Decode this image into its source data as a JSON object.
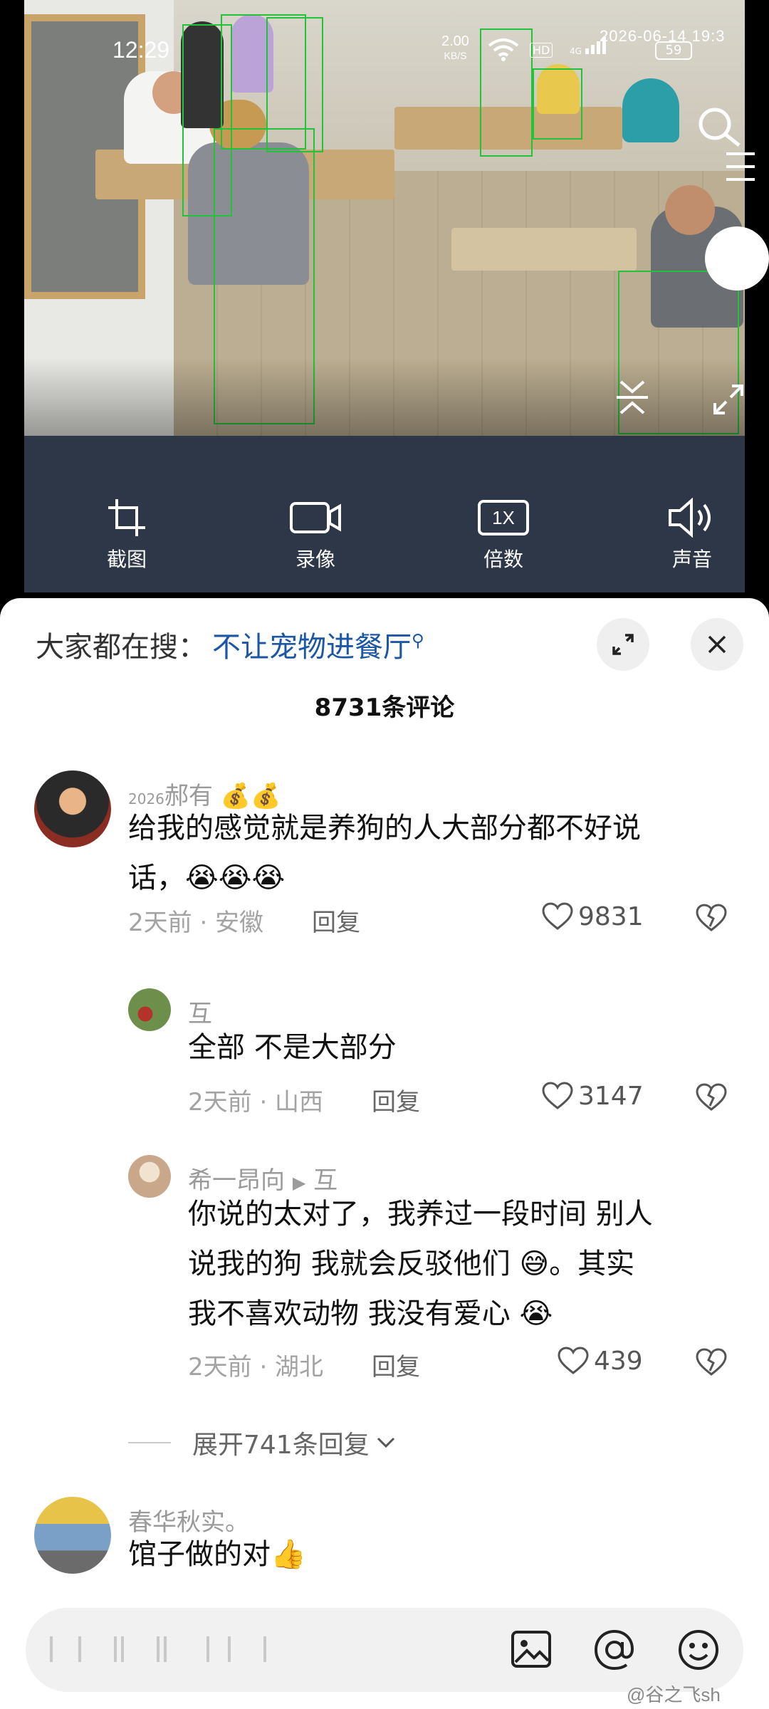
{
  "status_bar": {
    "time": "12:29",
    "net_speed": "2.00",
    "net_unit": "KB/S",
    "hd_badge": "HD",
    "signal_label": "4G",
    "timestamp": "2026-06-14 19:3",
    "battery": "59"
  },
  "video_controls": [
    {
      "label": "截图",
      "icon": "crop-icon"
    },
    {
      "label": "录像",
      "icon": "video-camera-icon"
    },
    {
      "label": "倍数",
      "icon": "speed-1x-icon",
      "badge": "1X"
    },
    {
      "label": "声音",
      "icon": "speaker-icon"
    }
  ],
  "sheet": {
    "search_prefix": "大家都在搜：",
    "search_term": "不让宠物进餐厅",
    "comment_count": "8731条评论"
  },
  "comments": [
    {
      "user": "郝有",
      "user_prefix": "2026",
      "text_line1": "给我的感觉就是养狗的人大部分都不好说",
      "text_line2": "话，",
      "time_location": "2天前 · 安徽",
      "reply_label": "回复",
      "likes": "9831"
    },
    {
      "user": "互",
      "text_line1": "全部   不是大部分",
      "time_location": "2天前 · 山西",
      "reply_label": "回复",
      "likes": "3147"
    },
    {
      "user": "希一昂向",
      "reply_to": "互",
      "text_line1": "你说的太对了，我养过一段时间   别人",
      "text_line2": "说我的狗   我就会反驳他们",
      "text_line2b": "。其实",
      "text_line3": "我不喜欢动物   我没有爱心",
      "time_location": "2天前 · 湖北",
      "reply_label": "回复",
      "likes": "439"
    },
    {
      "user": "春华秋实。",
      "text_line1": "馆子做的对"
    }
  ],
  "expand_replies": "展开741条回复",
  "watermark": "@谷之飞sh",
  "colors": {
    "accent_link": "#1b57a6",
    "controls_bg": "#2e3747",
    "detection_box": "#22c23a"
  }
}
